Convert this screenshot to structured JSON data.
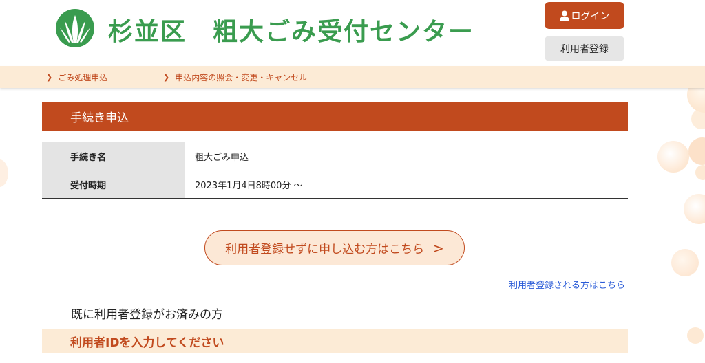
{
  "header": {
    "site_title": "杉並区　粗大ごみ受付センター",
    "logo_icon": "suginami-logo-icon",
    "login_label": "ログイン",
    "register_label": "利用者登録"
  },
  "nav": {
    "items": [
      {
        "label": "ごみ処理申込"
      },
      {
        "label": "申込内容の照会・変更・キャンセル"
      }
    ]
  },
  "section": {
    "title": "手続き申込"
  },
  "info_table": {
    "rows": [
      {
        "label": "手続き名",
        "value": "粗大ごみ申込"
      },
      {
        "label": "受付時期",
        "value": "2023年1月4日8時00分 〜"
      }
    ]
  },
  "actions": {
    "no_register_label": "利用者登録せずに申し込む方はこちら",
    "no_register_arrow": ">",
    "register_link": "利用者登録される方はこちら"
  },
  "login_area": {
    "already_registered": "既に利用者登録がお済みの方",
    "enter_id": "利用者IDを入力してください"
  },
  "colors": {
    "accent": "#c14a1e",
    "brand_green": "#3a9c4f",
    "nav_bg": "#fcebd6",
    "link": "#2a5bd7"
  }
}
